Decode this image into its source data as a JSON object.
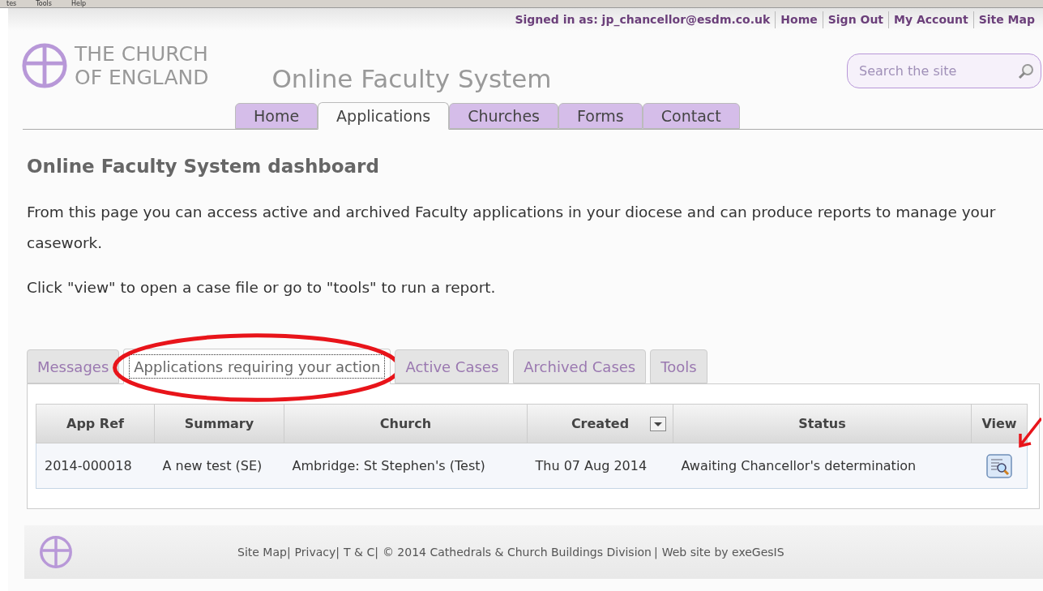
{
  "browser_menu": [
    "tes",
    "Tools",
    "Help"
  ],
  "top_bar": {
    "signed_in": "Signed in as: jp_chancellor@esdm.co.uk",
    "links": [
      "Home",
      "Sign Out",
      "My Account",
      "Site Map"
    ]
  },
  "logo": {
    "line1": "THE CHURCH",
    "line2": "OF ENGLAND"
  },
  "site_title": "Online Faculty System",
  "search": {
    "placeholder": "Search the site"
  },
  "nav_tabs": [
    {
      "label": "Home",
      "selected": false
    },
    {
      "label": "Applications",
      "selected": true
    },
    {
      "label": "Churches",
      "selected": false
    },
    {
      "label": "Forms",
      "selected": false
    },
    {
      "label": "Contact",
      "selected": false
    }
  ],
  "heading": "Online Faculty System dashboard",
  "paragraphs": [
    "From this page you can access active and archived Faculty applications in your diocese and can produce reports to manage your casework.",
    "Click \"view\" to open a case file or go to \"tools\" to run a report."
  ],
  "tabs": [
    {
      "label": "Messages",
      "selected": false,
      "circled": false
    },
    {
      "label": "Applications requiring your action",
      "selected": true,
      "circled": true
    },
    {
      "label": "Active Cases",
      "selected": false,
      "circled": false
    },
    {
      "label": "Archived Cases",
      "selected": false,
      "circled": false
    },
    {
      "label": "Tools",
      "selected": false,
      "circled": false
    }
  ],
  "table": {
    "columns": [
      {
        "label": "App Ref",
        "sortable": false
      },
      {
        "label": "Summary",
        "sortable": false
      },
      {
        "label": "Church",
        "sortable": false
      },
      {
        "label": "Created",
        "sortable": true
      },
      {
        "label": "Status",
        "sortable": false
      },
      {
        "label": "View",
        "sortable": false
      }
    ],
    "rows": [
      {
        "arrow_marked": true,
        "cells": [
          "2014-000018",
          "A new test (SE)",
          "Ambridge: St Stephen's (Test)",
          "Thu 07 Aug 2014",
          "Awaiting Chancellor's determination"
        ]
      }
    ]
  },
  "footer": {
    "items": [
      {
        "kind": "link",
        "text": "Site Map"
      },
      {
        "kind": "separator",
        "text": "|"
      },
      {
        "kind": "link",
        "text": "Privacy"
      },
      {
        "kind": "separator",
        "text": "|"
      },
      {
        "kind": "link",
        "text": "T & C"
      },
      {
        "kind": "separator",
        "text": "|"
      },
      {
        "kind": "text",
        "text": "© 2014 Cathedrals & Church Buildings Division"
      },
      {
        "kind": "separator",
        "text": "|"
      },
      {
        "kind": "text",
        "text": "Web site by exeGesIS"
      }
    ]
  }
}
